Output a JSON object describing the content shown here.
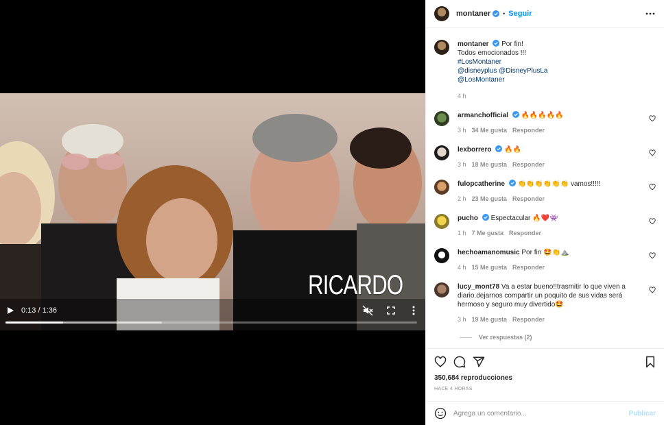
{
  "header": {
    "username": "montaner",
    "dot": "•",
    "follow_label": "Seguir",
    "more_icon": "more-horizontal-icon"
  },
  "caption": {
    "username": "montaner",
    "line1": "Por fin!",
    "line2": "Todos emocionados !!!",
    "hashtag": "#LosMontaner",
    "mentions1": "@disneyplus @DisneyPlusLa",
    "mentions2": "@LosMontaner",
    "time": "4 h"
  },
  "video": {
    "overlay_name": "RICARDO",
    "time_label": "0:13 / 1:36",
    "progress_played": 0.14,
    "progress_buffered": 0.38
  },
  "comments": [
    {
      "user": "armanchofficial",
      "verified": true,
      "text": "🔥🔥🔥🔥🔥",
      "time": "3 h",
      "likes": "34 Me gusta",
      "reply": "Responder"
    },
    {
      "user": "lexborrero",
      "verified": true,
      "text": "🔥🔥",
      "time": "3 h",
      "likes": "18 Me gusta",
      "reply": "Responder"
    },
    {
      "user": "fulopcatherine",
      "verified": true,
      "text": "👏👏👏👏👏👏 vamos!!!!!",
      "time": "2 h",
      "likes": "23 Me gusta",
      "reply": "Responder"
    },
    {
      "user": "pucho",
      "verified": true,
      "text": "Espectacular 🔥❤️👾",
      "time": "1 h",
      "likes": "7 Me gusta",
      "reply": "Responder"
    },
    {
      "user": "hechoamanomusic",
      "verified": false,
      "text": "Por fin 🤩👏⛰️",
      "time": "4 h",
      "likes": "15 Me gusta",
      "reply": "Responder"
    },
    {
      "user": "lucy_mont78",
      "verified": false,
      "text": "Va a estar bueno!!trasmitir lo que viven a diario.dejarnos compartir un poquito de sus vidas será hermoso y seguro muy divertido🤩",
      "time": "3 h",
      "likes": "19 Me gusta",
      "reply": "Responder"
    }
  ],
  "view_replies": "Ver respuestas (2)",
  "stats": {
    "views": "350,684 reproducciones",
    "posted": "HACE 4 HORAS"
  },
  "add_comment": {
    "placeholder": "Agrega un comentario...",
    "publish": "Publicar"
  },
  "colors": {
    "accent": "#0095f6",
    "verified": "#3897f0",
    "link": "#00376b",
    "publish_disabled": "#b2dffc"
  }
}
